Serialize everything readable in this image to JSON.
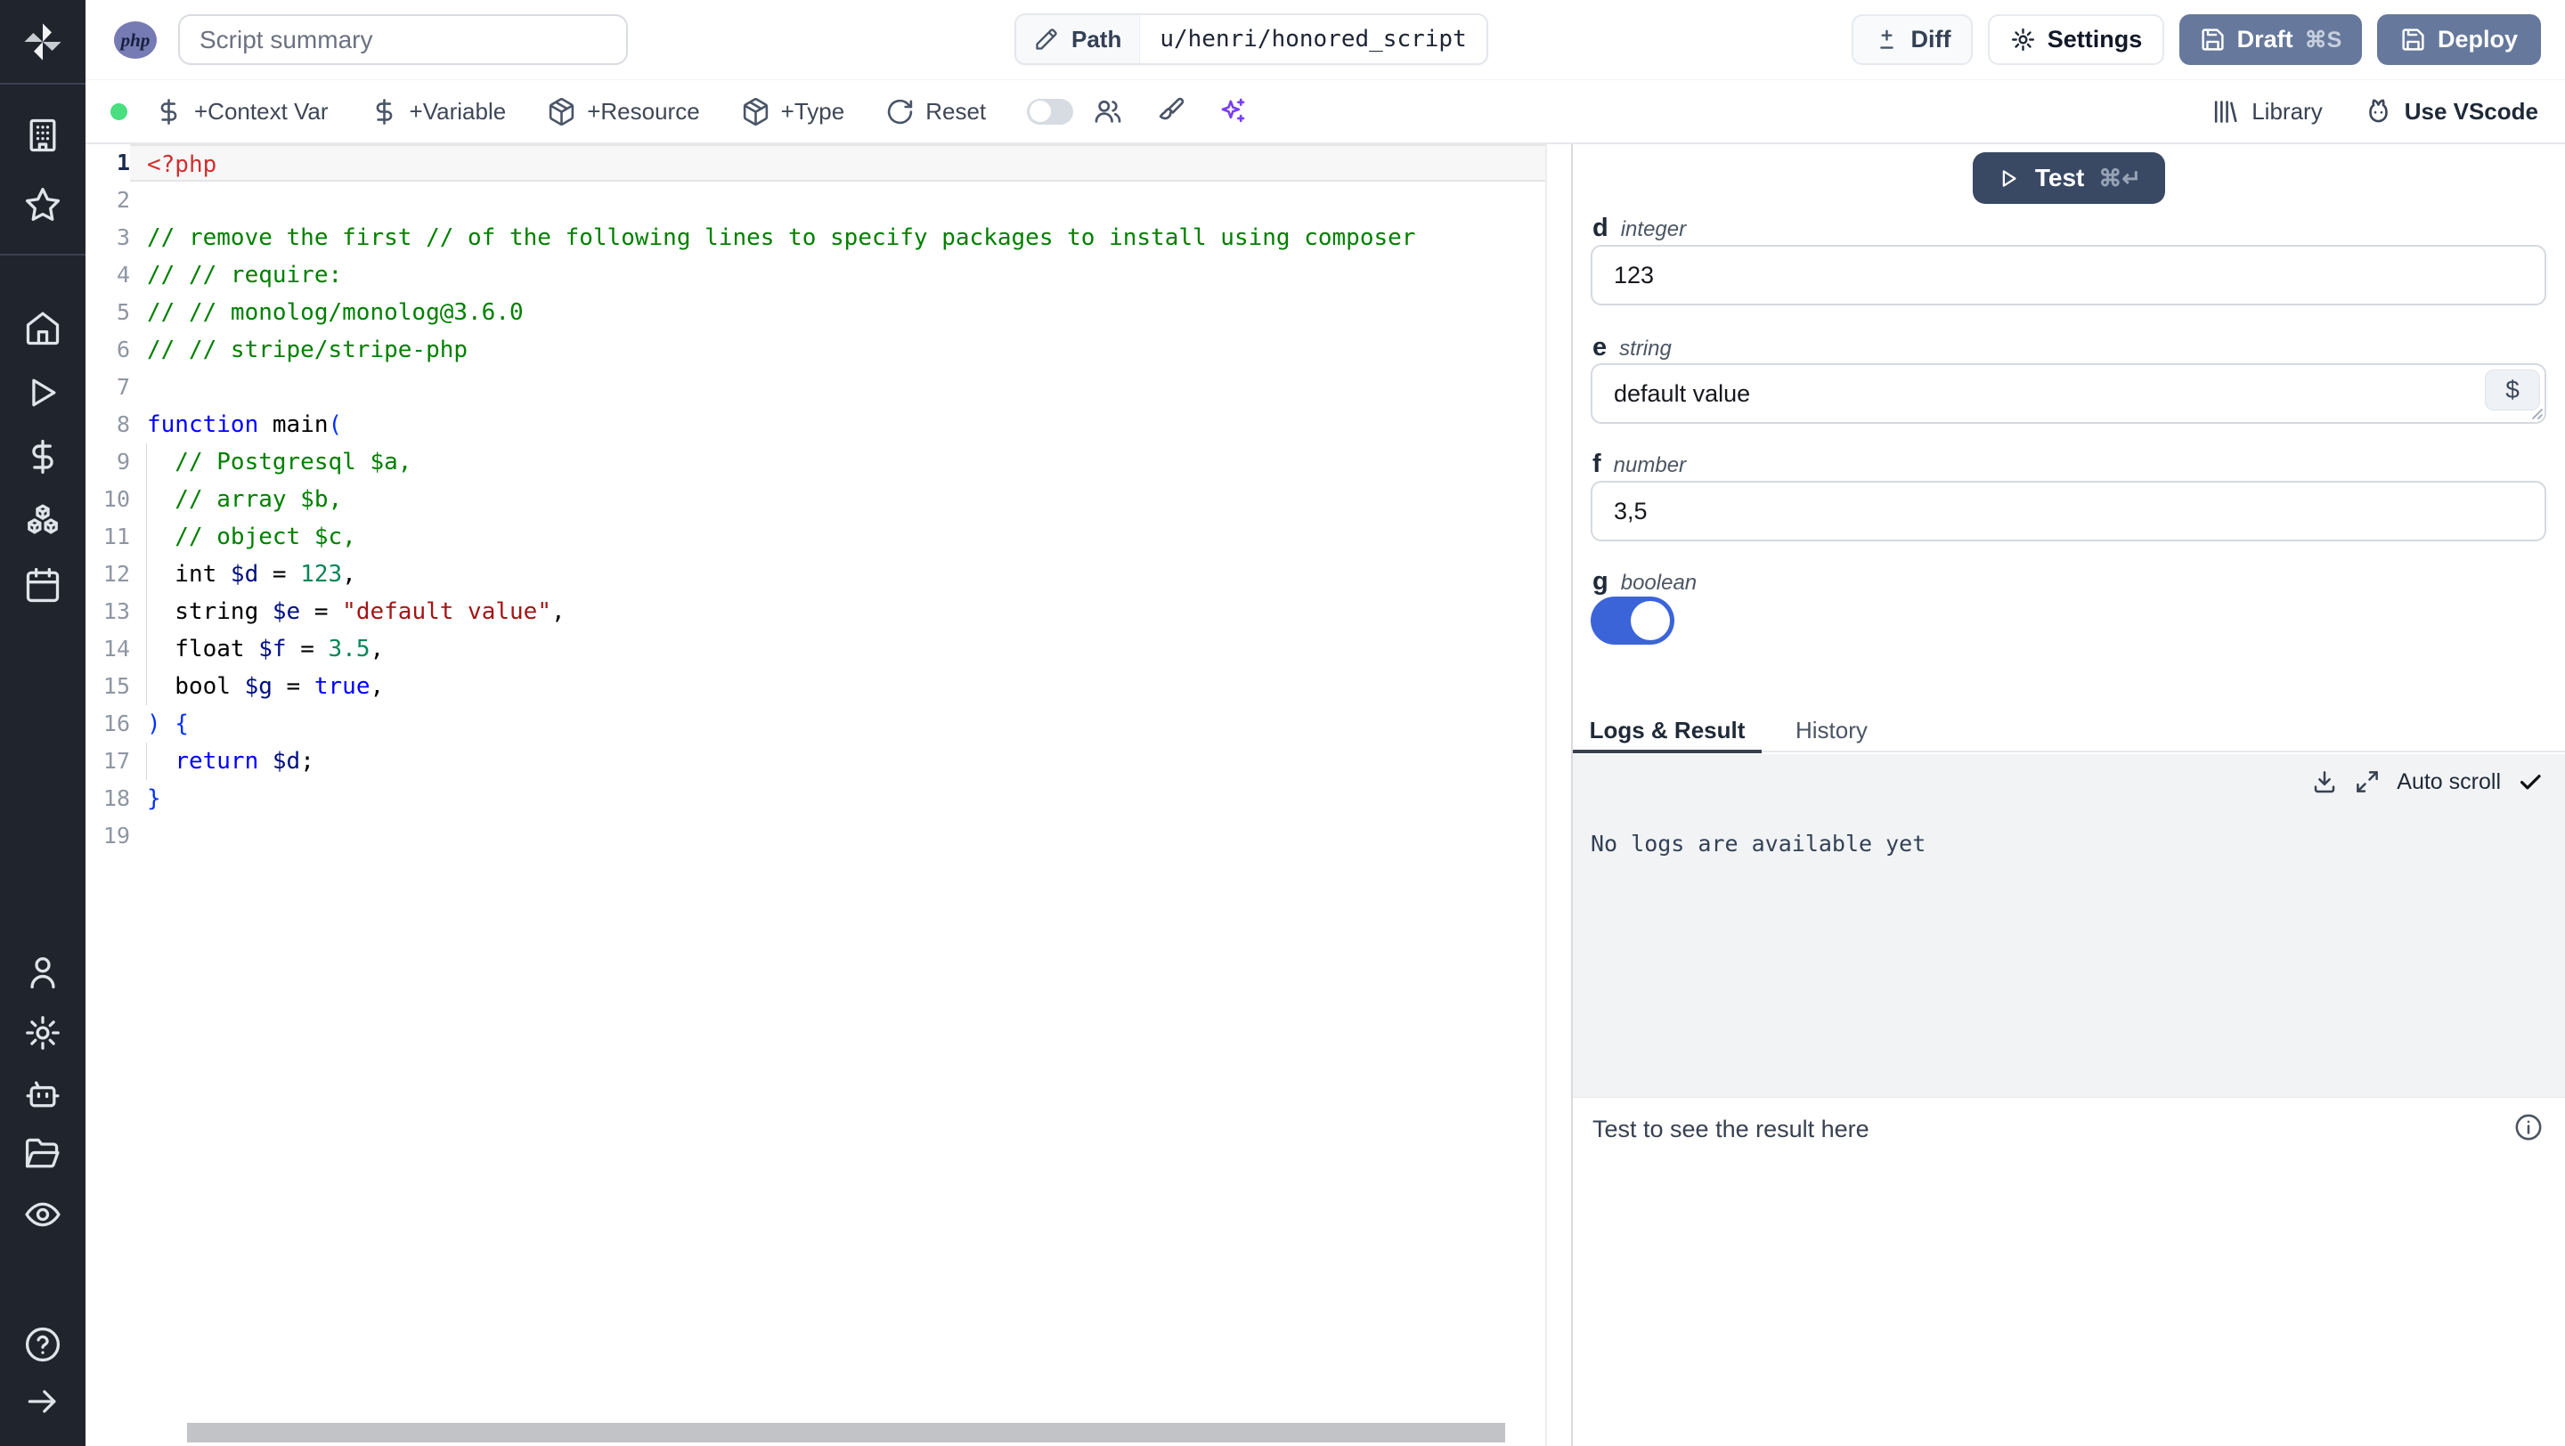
{
  "colors": {
    "accent_toggle_blue": "#3b64d8",
    "deploy_button_slate": "#66799c",
    "test_button_navy": "#394963",
    "status_dot_green": "#4ade80",
    "sparkles_purple": "#7a3ff2",
    "php_badge_purple": "#777bb4",
    "log_area_bg": "#f1f3f5",
    "sidebar_bg": "#20242d"
  },
  "sidebar": {
    "groups": [
      {
        "name": "workspace",
        "icons": [
          "building",
          "star"
        ]
      },
      {
        "name": "main",
        "icons": [
          "home",
          "play",
          "dollar",
          "boxes",
          "calendar"
        ]
      },
      {
        "name": "account",
        "icons": [
          "user",
          "gear",
          "robot",
          "folder-open",
          "eye"
        ]
      },
      {
        "name": "footer",
        "icons": [
          "help-circle",
          "arrow-right"
        ]
      }
    ]
  },
  "topbar": {
    "language_badge": "php",
    "summary_placeholder": "Script summary",
    "path_label": "Path",
    "path_value": "u/henri/honored_script",
    "diff_label": "Diff",
    "settings_label": "Settings",
    "draft_label": "Draft",
    "draft_shortcut": "⌘S",
    "deploy_label": "Deploy"
  },
  "toolbar": {
    "add_context_var": "+Context Var",
    "add_variable": "+Variable",
    "add_resource": "+Resource",
    "add_type": "+Type",
    "reset": "Reset",
    "library_label": "Library",
    "vscode_label": "Use VScode"
  },
  "editor": {
    "active_line": 1,
    "lines": [
      {
        "n": 1,
        "tokens": [
          {
            "t": "<?php",
            "c": "phptag"
          }
        ]
      },
      {
        "n": 2,
        "tokens": []
      },
      {
        "n": 3,
        "tokens": [
          {
            "t": "// remove the first // of the following lines to specify packages to install using composer",
            "c": "comment"
          }
        ]
      },
      {
        "n": 4,
        "tokens": [
          {
            "t": "// // require:",
            "c": "comment"
          }
        ]
      },
      {
        "n": 5,
        "tokens": [
          {
            "t": "// // monolog/monolog@3.6.0",
            "c": "comment"
          }
        ]
      },
      {
        "n": 6,
        "tokens": [
          {
            "t": "// // stripe/stripe-php",
            "c": "comment"
          }
        ]
      },
      {
        "n": 7,
        "tokens": []
      },
      {
        "n": 8,
        "tokens": [
          {
            "t": "function",
            "c": "kw"
          },
          {
            "t": " main",
            "c": "plain"
          },
          {
            "t": "(",
            "c": "bracket"
          }
        ]
      },
      {
        "n": 9,
        "guide": true,
        "tokens": [
          {
            "t": "  // Postgresql $a,",
            "c": "comment"
          }
        ]
      },
      {
        "n": 10,
        "guide": true,
        "tokens": [
          {
            "t": "  // array $b,",
            "c": "comment"
          }
        ]
      },
      {
        "n": 11,
        "guide": true,
        "tokens": [
          {
            "t": "  // object $c,",
            "c": "comment"
          }
        ]
      },
      {
        "n": 12,
        "guide": true,
        "tokens": [
          {
            "t": "  int ",
            "c": "plain"
          },
          {
            "t": "$d",
            "c": "var"
          },
          {
            "t": " = ",
            "c": "plain"
          },
          {
            "t": "123",
            "c": "num"
          },
          {
            "t": ",",
            "c": "plain"
          }
        ]
      },
      {
        "n": 13,
        "guide": true,
        "tokens": [
          {
            "t": "  string ",
            "c": "plain"
          },
          {
            "t": "$e",
            "c": "var"
          },
          {
            "t": " = ",
            "c": "plain"
          },
          {
            "t": "\"default value\"",
            "c": "str"
          },
          {
            "t": ",",
            "c": "plain"
          }
        ]
      },
      {
        "n": 14,
        "guide": true,
        "tokens": [
          {
            "t": "  float ",
            "c": "plain"
          },
          {
            "t": "$f",
            "c": "var"
          },
          {
            "t": " = ",
            "c": "plain"
          },
          {
            "t": "3.5",
            "c": "num"
          },
          {
            "t": ",",
            "c": "plain"
          }
        ]
      },
      {
        "n": 15,
        "guide": true,
        "tokens": [
          {
            "t": "  bool ",
            "c": "plain"
          },
          {
            "t": "$g",
            "c": "var"
          },
          {
            "t": " = ",
            "c": "plain"
          },
          {
            "t": "true",
            "c": "kw"
          },
          {
            "t": ",",
            "c": "plain"
          }
        ]
      },
      {
        "n": 16,
        "tokens": [
          {
            "t": ") {",
            "c": "bracket"
          }
        ]
      },
      {
        "n": 17,
        "guide": true,
        "tokens": [
          {
            "t": "  ",
            "c": "plain"
          },
          {
            "t": "return",
            "c": "kw"
          },
          {
            "t": " ",
            "c": "plain"
          },
          {
            "t": "$d",
            "c": "var"
          },
          {
            "t": ";",
            "c": "plain"
          }
        ]
      },
      {
        "n": 18,
        "tokens": [
          {
            "t": "}",
            "c": "bracket"
          }
        ]
      },
      {
        "n": 19,
        "tokens": []
      }
    ]
  },
  "run_panel": {
    "test_label": "Test",
    "test_shortcut": "⌘↵",
    "args": {
      "d": {
        "name": "d",
        "type": "integer",
        "value": "123"
      },
      "e": {
        "name": "e",
        "type": "string",
        "value": "default value",
        "var_button": "$"
      },
      "f": {
        "name": "f",
        "type": "number",
        "value": "3,5"
      },
      "g": {
        "name": "g",
        "type": "boolean",
        "value": true
      }
    },
    "tabs": {
      "logs": "Logs & Result",
      "history": "History"
    },
    "active_tab": "Logs & Result",
    "auto_scroll_label": "Auto scroll",
    "no_logs_text": "No logs are available yet",
    "result_placeholder": "Test to see the result here"
  }
}
